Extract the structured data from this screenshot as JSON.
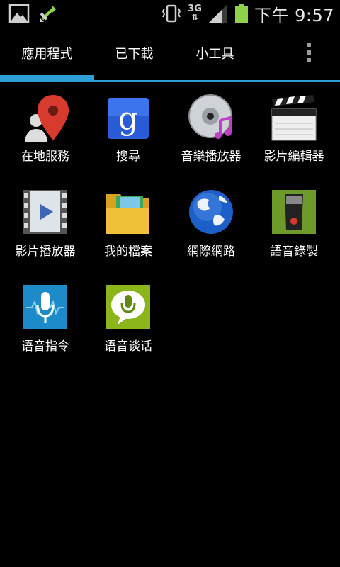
{
  "status_bar": {
    "network_type": "3G",
    "time": "下午 9:57",
    "icons": [
      "gallery-icon",
      "sync-icon",
      "vibrate-icon",
      "signal-icon",
      "battery-icon"
    ]
  },
  "tabs": [
    {
      "label": "應用程式",
      "selected": true
    },
    {
      "label": "已下載",
      "selected": false
    },
    {
      "label": "小工具",
      "selected": false
    }
  ],
  "accent_color": "#2f9fd8",
  "apps": [
    {
      "label": "在地服務",
      "icon": "maps-pin-icon"
    },
    {
      "label": "搜尋",
      "icon": "google-search-icon"
    },
    {
      "label": "音樂播放器",
      "icon": "music-cd-icon"
    },
    {
      "label": "影片編輯器",
      "icon": "clapperboard-icon"
    },
    {
      "label": "影片播放器",
      "icon": "film-strip-play-icon"
    },
    {
      "label": "我的檔案",
      "icon": "folder-icon"
    },
    {
      "label": "網際網路",
      "icon": "globe-icon"
    },
    {
      "label": "語音錄製",
      "icon": "voice-recorder-icon"
    },
    {
      "label": "语音指令",
      "icon": "microphone-icon"
    },
    {
      "label": "语音谈话",
      "icon": "speech-bubble-mic-icon"
    }
  ]
}
